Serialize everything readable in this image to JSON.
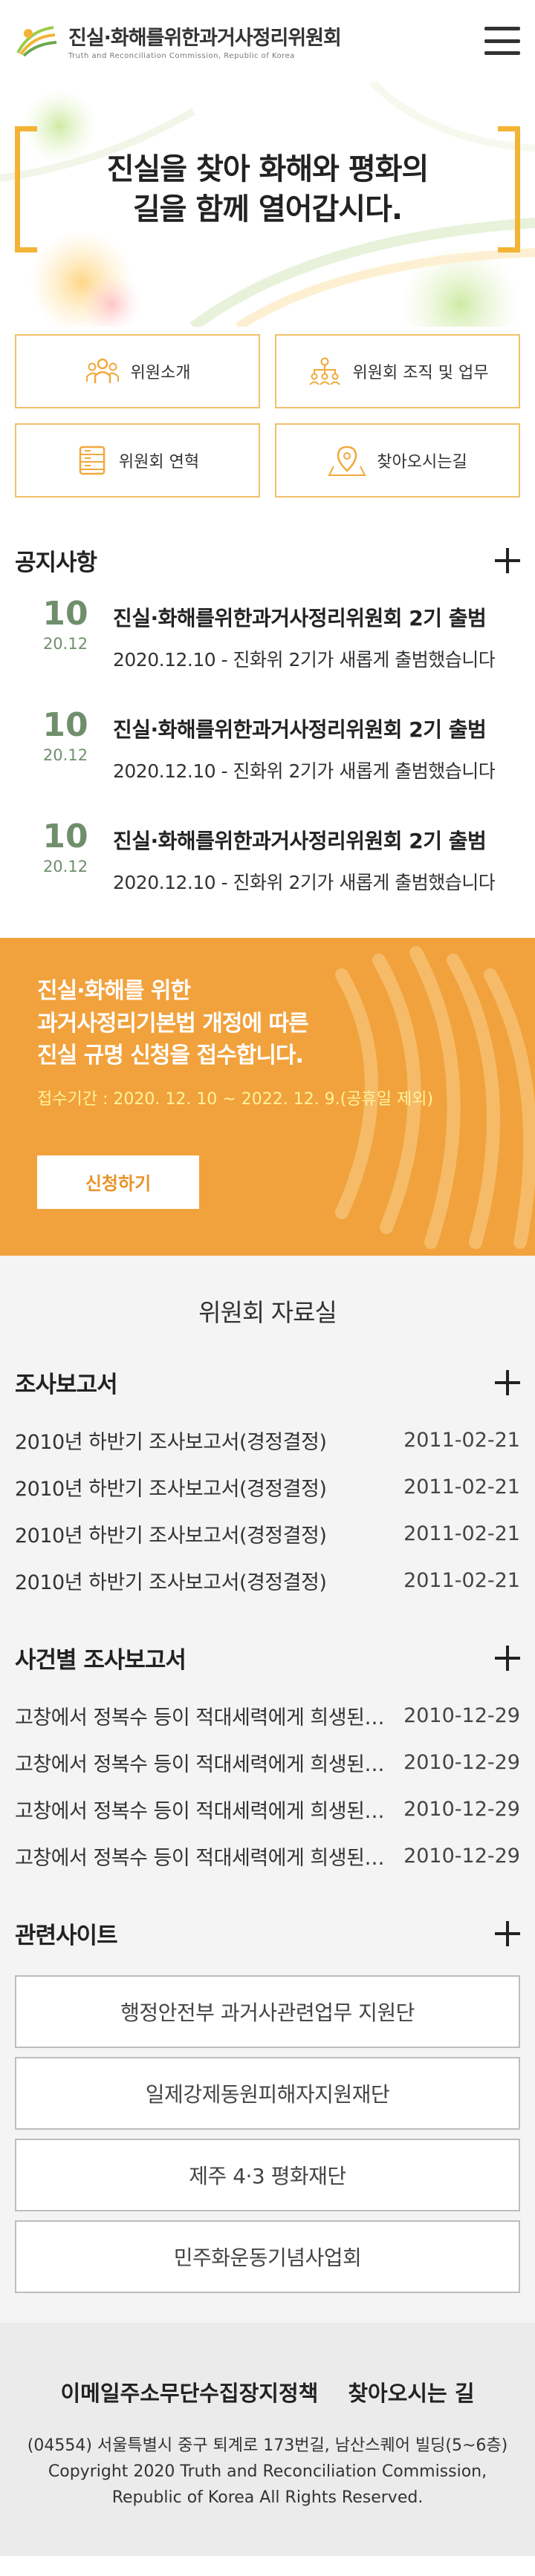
{
  "header": {
    "title": "진실·화해를위한과거사정리위원회",
    "subtitle": "Truth and Reconciliation Commission, Republic of Korea",
    "icons": {
      "logo": "trc-logo",
      "menu": "hamburger-menu-icon"
    }
  },
  "hero": {
    "line1": "진실을 찾아 화해와 평화의",
    "line2": "길을 함께 열어갑시다."
  },
  "quick_links": [
    {
      "label": "위원소개",
      "icon": "people-icon"
    },
    {
      "label": "위원회 조직 및 업무",
      "icon": "organization-icon"
    },
    {
      "label": "위원회 연혁",
      "icon": "history-icon"
    },
    {
      "label": "찾아오시는길",
      "icon": "map-pin-icon"
    }
  ],
  "notices": {
    "title": "공지사항",
    "items": [
      {
        "day": "10",
        "ym": "20.12",
        "title": "진실·화해를위한과거사정리위원회 2기 출범",
        "desc": "2020.12.10 -  진화위 2기가 새롭게 출범했습니다"
      },
      {
        "day": "10",
        "ym": "20.12",
        "title": "진실·화해를위한과거사정리위원회 2기 출범",
        "desc": "2020.12.10 -  진화위 2기가 새롭게 출범했습니다"
      },
      {
        "day": "10",
        "ym": "20.12",
        "title": "진실·화해를위한과거사정리위원회 2기 출범",
        "desc": "2020.12.10 -  진화위 2기가 새롭게 출범했습니다"
      }
    ]
  },
  "banner": {
    "line1": "진실·화해를 위한",
    "line2": "과거사정리기본법 개정에 따른",
    "line3": "진실 규명 신청을 접수합니다.",
    "period": "접수기간 : 2020. 12. 10 ~ 2022. 12. 9.(공휴일 제외)",
    "button": "신청하기"
  },
  "archive": {
    "title": "위원회 자료실",
    "reports": {
      "title": "조사보고서",
      "items": [
        {
          "title": "2010년 하반기 조사보고서(경정결정)",
          "date": "2011-02-21"
        },
        {
          "title": "2010년 하반기 조사보고서(경정결정)",
          "date": "2011-02-21"
        },
        {
          "title": "2010년 하반기 조사보고서(경정결정)",
          "date": "2011-02-21"
        },
        {
          "title": "2010년 하반기 조사보고서(경정결정)",
          "date": "2011-02-21"
        }
      ]
    },
    "case_reports": {
      "title": "사건별 조사보고서",
      "items": [
        {
          "title": "고창에서 정복수 등이 적대세력에게 희생된 사건",
          "date": "2010-12-29"
        },
        {
          "title": "고창에서 정복수 등이 적대세력에게 희생된 사건",
          "date": "2010-12-29"
        },
        {
          "title": "고창에서 정복수 등이 적대세력에게 희생된 사건",
          "date": "2010-12-29"
        },
        {
          "title": "고창에서 정복수 등이 적대세력에게 희생된 사건",
          "date": "2010-12-29"
        }
      ]
    },
    "related": {
      "title": "관련사이트",
      "items": [
        "행정안전부 과거사관련업무 지원단",
        "일제강제동원피해자지원재단",
        "제주 4·3 평화재단",
        "민주화운동기념사업회"
      ]
    }
  },
  "footer": {
    "link1": "이메일주소무단수집장지정책",
    "link2": "찾아오시는 길",
    "address": "(04554) 서울특별시 중구 퇴계로 173번길, 남산스퀘어 빌딩(5~6층)",
    "copy1": "Copyright 2020 Truth and Reconciliation Commission,",
    "copy2": "Republic of Korea All Rights Reserved."
  },
  "colors": {
    "accent": "#f3b335",
    "banner_bg": "#f1a23c",
    "date_green": "#6f8f6b",
    "archive_bg": "#f4f4f4",
    "footer_bg": "#ebebeb"
  }
}
